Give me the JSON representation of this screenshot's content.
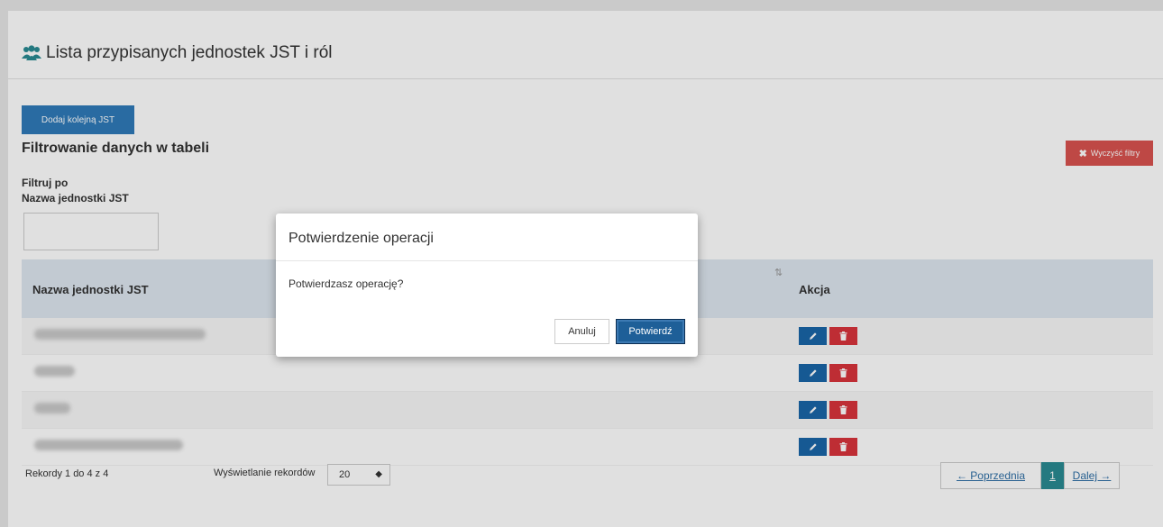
{
  "header": {
    "title": "Lista przypisanych jednostek JST i ról",
    "icon": "users-icon"
  },
  "toolbar": {
    "add_label": "Dodaj kolejną JST"
  },
  "filters": {
    "heading": "Filtrowanie danych w tabeli",
    "clear_label": "Wyczyść filtry",
    "filter_by_label": "Filtruj po",
    "field_label": "Nazwa jednostki JST",
    "value": ""
  },
  "table": {
    "columns": [
      "Nazwa jednostki JST",
      "Akcja"
    ],
    "rows": [
      {
        "name_width": 190
      },
      {
        "name_width": 45
      },
      {
        "name_width": 40
      },
      {
        "name_width": 165
      }
    ]
  },
  "footer": {
    "records_text": "Rekordy 1 do 4 z 4",
    "show_label": "Wyświetlanie rekordów",
    "page_size": "20"
  },
  "pagination": {
    "prev": "← Poprzednia",
    "current": "1",
    "next": "Dalej →"
  },
  "modal": {
    "title": "Potwierdzenie operacji",
    "body": "Potwierdzasz operację?",
    "cancel": "Anuluj",
    "confirm": "Potwierdź"
  },
  "colors": {
    "primary": "#2f7ab9",
    "danger": "#d9534f",
    "header_bg": "#dde6f0",
    "page_active": "#2a8a92"
  }
}
